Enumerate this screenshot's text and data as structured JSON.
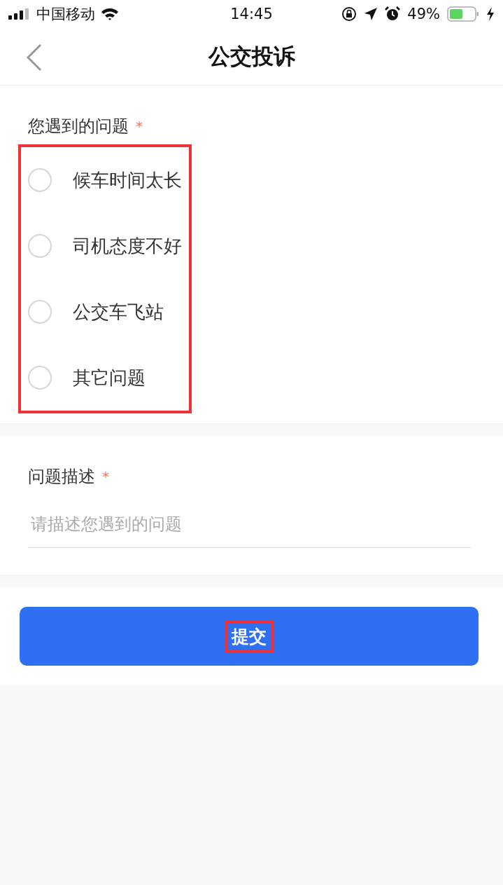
{
  "status_bar": {
    "carrier": "中国移动",
    "time": "14:45",
    "battery": "49%"
  },
  "nav": {
    "title": "公交投诉"
  },
  "question": {
    "label": "您遇到的问题",
    "required_mark": "*",
    "highlighted": true,
    "options": [
      {
        "label": "候车时间太长",
        "selected": false
      },
      {
        "label": "司机态度不好",
        "selected": false
      },
      {
        "label": "公交车飞站",
        "selected": false
      },
      {
        "label": "其它问题",
        "selected": false
      }
    ]
  },
  "description": {
    "label": "问题描述",
    "required_mark": "*",
    "placeholder": "请描述您遇到的问题"
  },
  "submit": {
    "label": "提交",
    "highlighted": true
  }
}
